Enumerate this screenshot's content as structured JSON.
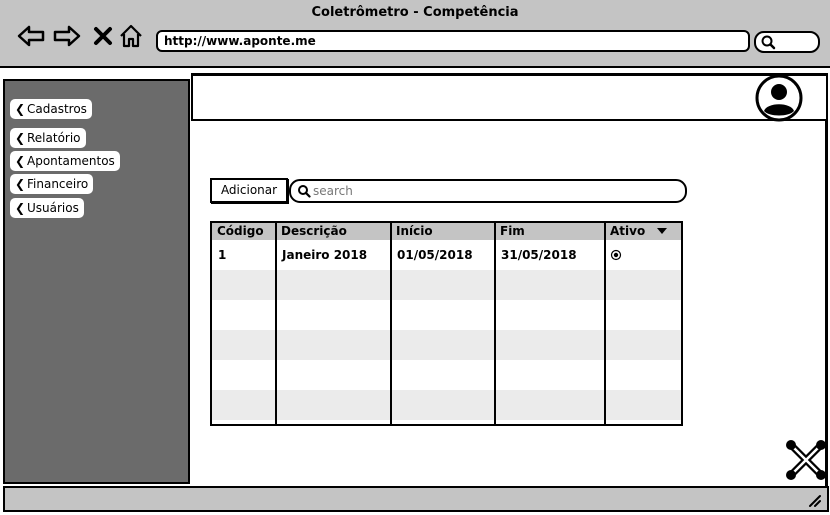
{
  "window": {
    "title": "Coletrômetro - Competência",
    "address": "http://www.aponte.me"
  },
  "sidebar": {
    "items": [
      {
        "label": "Cadastros",
        "icon": "chevron-left-icon"
      },
      {
        "label": "Relatório",
        "icon": "chevron-left-icon"
      },
      {
        "label": "Apontamentos",
        "icon": "chevron-left-icon"
      },
      {
        "label": "Financeiro",
        "icon": "chevron-left-icon"
      },
      {
        "label": "Usuários",
        "icon": "chevron-left-icon"
      }
    ]
  },
  "toolbar": {
    "add_label": "Adicionar",
    "search_placeholder": "search"
  },
  "table": {
    "columns": [
      "Código",
      "Descrição",
      "Início",
      "Fim",
      "Ativo"
    ],
    "rows": [
      {
        "codigo": "1",
        "descricao": "Janeiro 2018",
        "inicio": "01/05/2018",
        "fim": "31/05/2018",
        "ativo": "selected"
      }
    ]
  },
  "colors": {
    "chrome": "#c4c4c4",
    "sidebar": "#6b6b6b",
    "row_alt": "#ebebeb"
  }
}
